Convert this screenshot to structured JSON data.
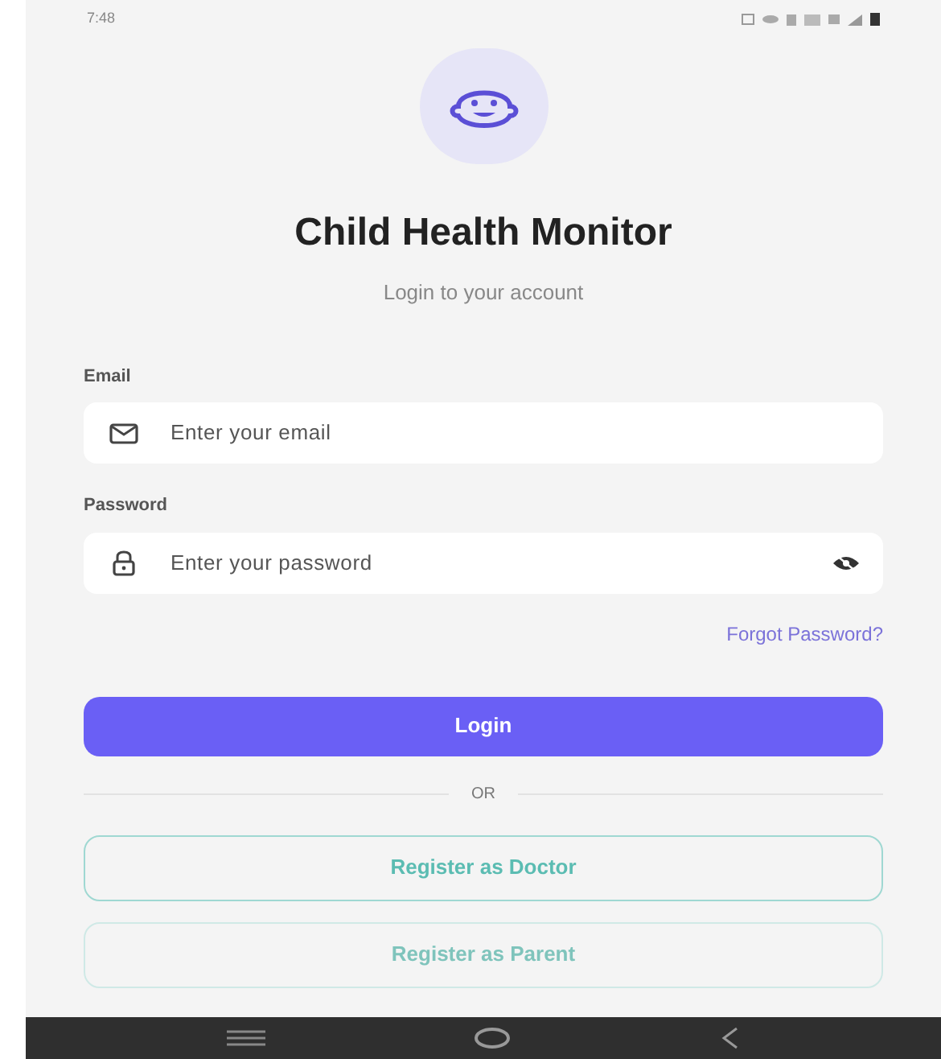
{
  "status_bar": {
    "time": "7:48"
  },
  "header": {
    "title": "Child Health Monitor",
    "subtitle": "Login to your account"
  },
  "fields": [
    {
      "label": "Email",
      "placeholder": "Enter your email",
      "kind": "email"
    },
    {
      "label": "Password",
      "placeholder": "Enter your password",
      "kind": "password"
    }
  ],
  "forgot_link": "Forgot Password?",
  "login_button": "Login",
  "divider": "OR",
  "register_buttons": [
    {
      "label": "Register as Doctor",
      "disabled": false
    },
    {
      "label": "Register as Parent",
      "disabled": true
    }
  ]
}
